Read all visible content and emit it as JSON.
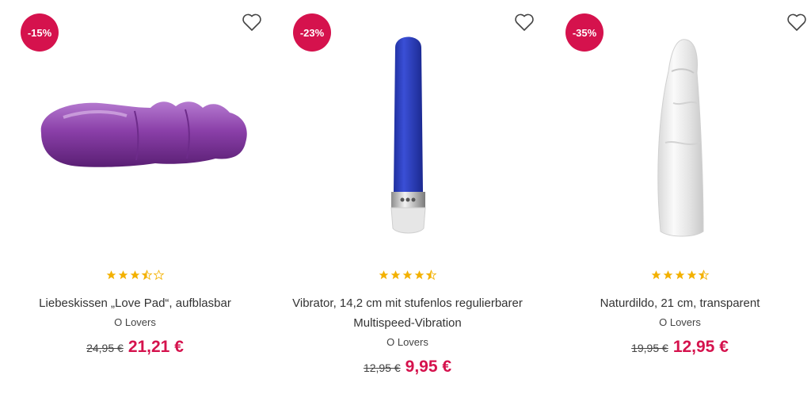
{
  "products": [
    {
      "discount": "-15%",
      "name": "Liebeskissen „Love Pad“, aufblasbar",
      "brand": "O Lovers",
      "old_price": "24,95 €",
      "new_price": "21,21 €",
      "rating": 3.5,
      "image": "purple-inflatable-pad"
    },
    {
      "discount": "-23%",
      "name": "Vibrator, 14,2 cm mit stufenlos regulierbarer Multispeed-Vibration",
      "brand": "O Lovers",
      "old_price": "12,95 €",
      "new_price": "9,95 €",
      "rating": 4.5,
      "image": "blue-vibrator"
    },
    {
      "discount": "-35%",
      "name": "Naturdildo, 21 cm, transparent",
      "brand": "O Lovers",
      "old_price": "19,95 €",
      "new_price": "12,95 €",
      "rating": 4.5,
      "image": "transparent-dildo"
    }
  ],
  "icons": {
    "wishlist": "heart-outline-icon",
    "rating": "star-icon"
  },
  "colors": {
    "accent": "#d5124d",
    "star": "#f3b100",
    "star_empty": "#f3b100"
  }
}
